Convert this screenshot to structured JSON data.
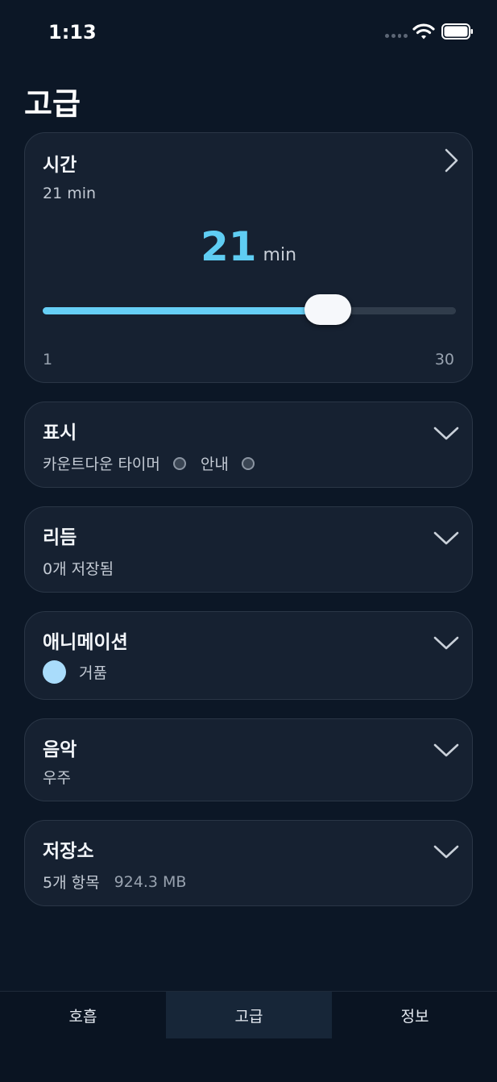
{
  "status_bar": {
    "time": "1:13"
  },
  "page": {
    "title": "고급"
  },
  "time_card": {
    "title": "시간",
    "subtitle": "21 min",
    "value": "21",
    "unit": "min",
    "slider": {
      "min": 1,
      "max": 30,
      "value": 21,
      "min_label": "1",
      "max_label": "30"
    }
  },
  "display_card": {
    "title": "표시",
    "option1": "카운트다운 타이머",
    "option2": "안내"
  },
  "rhythm_card": {
    "title": "리듬",
    "subtitle": "0개 저장됨"
  },
  "animation_card": {
    "title": "애니메이션",
    "selected": "거품"
  },
  "music_card": {
    "title": "음악",
    "subtitle": "우주"
  },
  "storage_card": {
    "title": "저장소",
    "items": "5개 항목",
    "size": "924.3 MB"
  },
  "tabs": [
    {
      "label": "호흡",
      "active": false
    },
    {
      "label": "고급",
      "active": true
    },
    {
      "label": "정보",
      "active": false
    }
  ],
  "colors": {
    "background": "#0c1726",
    "card": "#162131",
    "accent": "#5fcdf3",
    "bubble": "#a9dcfb"
  }
}
